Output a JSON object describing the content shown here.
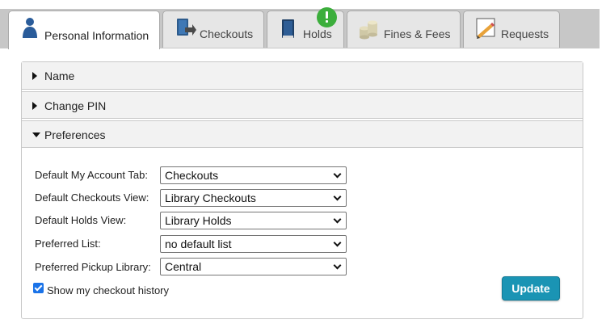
{
  "tabs": [
    {
      "label": "Personal Information",
      "icon": "person-icon",
      "active": true
    },
    {
      "label": "Checkouts",
      "icon": "checkout-book-icon",
      "active": false
    },
    {
      "label": "Holds",
      "icon": "book-icon",
      "active": false,
      "badge": "alert-badge"
    },
    {
      "label": "Fines & Fees",
      "icon": "coins-icon",
      "active": false
    },
    {
      "label": "Requests",
      "icon": "pencil-note-icon",
      "active": false
    }
  ],
  "accordion": {
    "name": "Name",
    "change_pin": "Change PIN",
    "preferences": "Preferences"
  },
  "preferences": {
    "fields": [
      {
        "label": "Default My Account Tab:",
        "value": "Checkouts"
      },
      {
        "label": "Default Checkouts View:",
        "value": "Library Checkouts"
      },
      {
        "label": "Default Holds View:",
        "value": "Library Holds"
      },
      {
        "label": "Preferred List:",
        "value": "no default list"
      },
      {
        "label": "Preferred Pickup Library:",
        "value": "Central"
      }
    ],
    "show_history_label": "Show my checkout history",
    "show_history_checked": true,
    "update_label": "Update"
  },
  "colors": {
    "accent": "#1a94b4",
    "badge": "#3cae3c",
    "checkbox": "#1a73e8"
  }
}
